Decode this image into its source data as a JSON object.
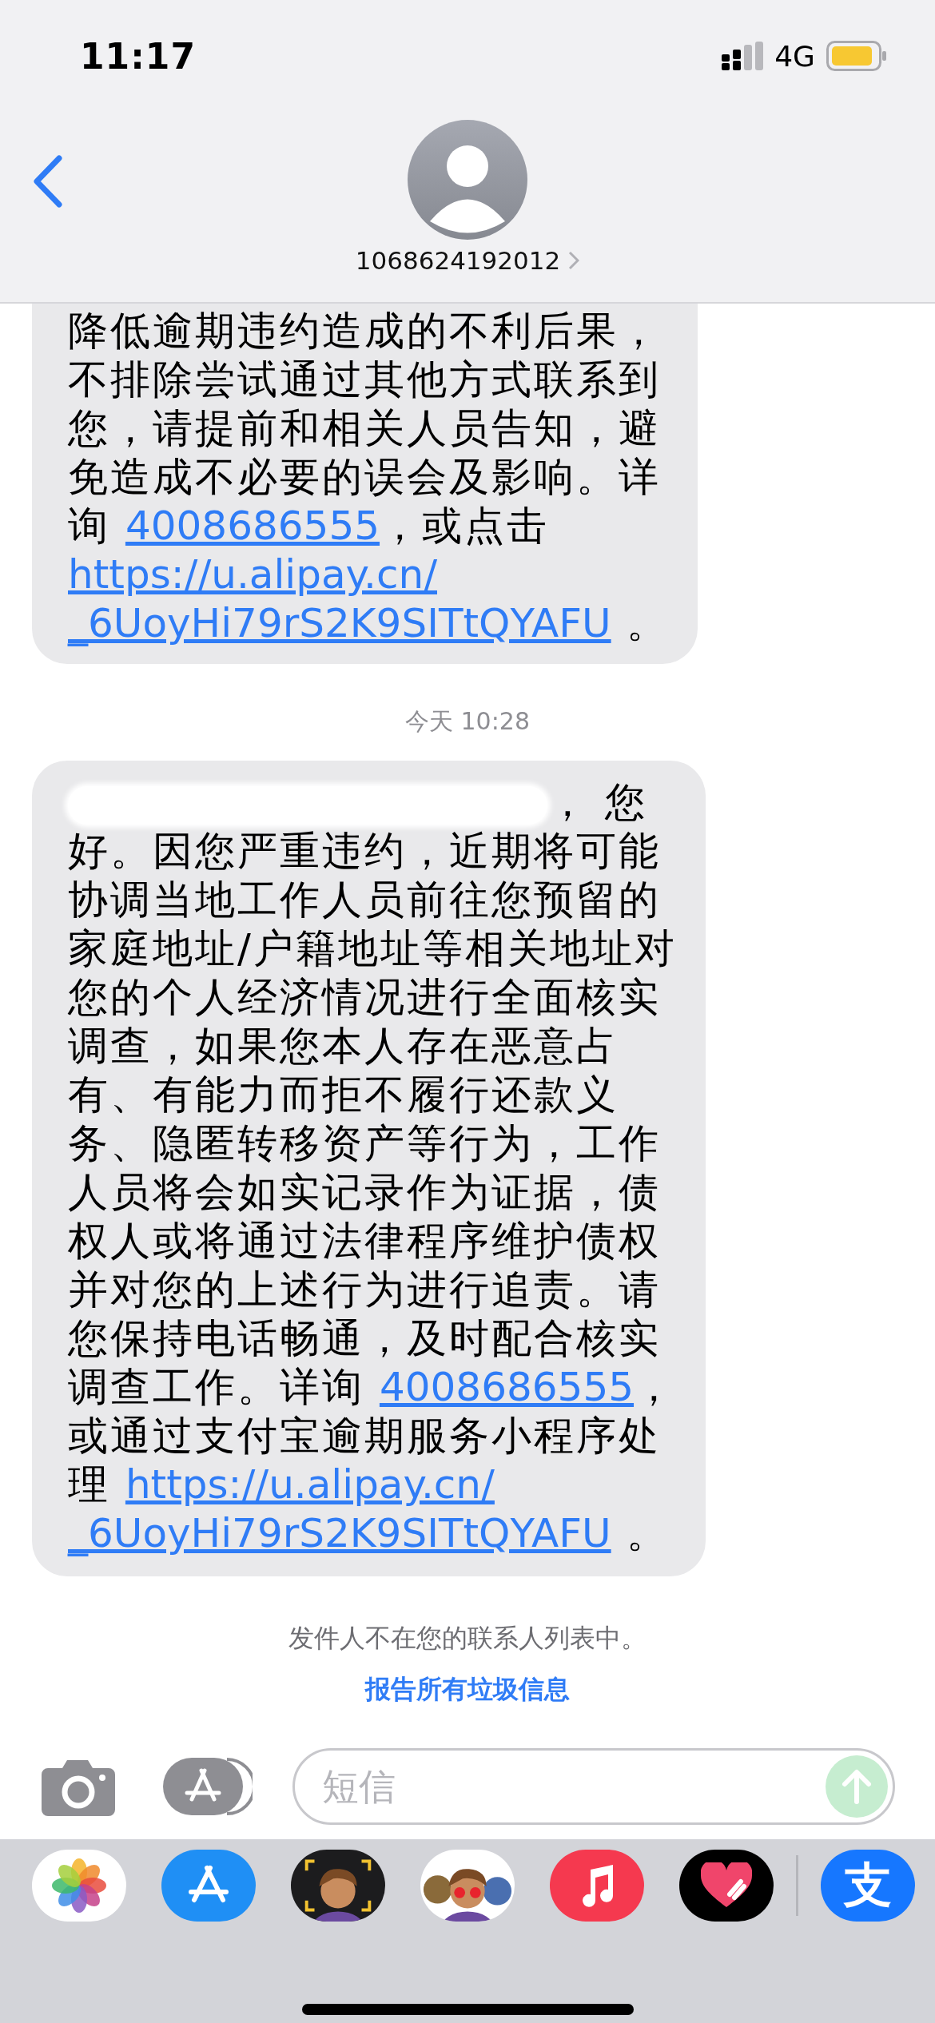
{
  "status_bar": {
    "time": "11:17",
    "network": "4G"
  },
  "header": {
    "contact": "1068624192012"
  },
  "conversation": [
    {
      "kind": "message",
      "cut_top": true,
      "segments": [
        {
          "kind": "text",
          "text": "降低逾期违约造成的不利后果，"
        },
        {
          "kind": "break"
        },
        {
          "kind": "text",
          "text": "不排除尝试通过其他方式联系到"
        },
        {
          "kind": "break"
        },
        {
          "kind": "text",
          "text": "您，请提前和相关人员告知，避"
        },
        {
          "kind": "break"
        },
        {
          "kind": "text",
          "text": "免造成不必要的误会及影响。详"
        },
        {
          "kind": "break"
        },
        {
          "kind": "text",
          "text": "询 "
        },
        {
          "kind": "link",
          "text": "4008686555"
        },
        {
          "kind": "text",
          "text": "，或点击"
        },
        {
          "kind": "break"
        },
        {
          "kind": "link",
          "text": "https://u.alipay.cn/"
        },
        {
          "kind": "break"
        },
        {
          "kind": "link",
          "text": "_6UoyHi79rS2K9SITtQYAFU"
        },
        {
          "kind": "text",
          "text": " 。"
        }
      ]
    },
    {
      "kind": "timestamp",
      "text": "今天 10:28"
    },
    {
      "kind": "message",
      "cut_top": false,
      "segments": [
        {
          "kind": "redacted"
        },
        {
          "kind": "text",
          "text": "， 您"
        },
        {
          "kind": "break"
        },
        {
          "kind": "text",
          "text": "好。因您严重违约，近期将可能"
        },
        {
          "kind": "break"
        },
        {
          "kind": "text",
          "text": "协调当地工作人员前往您预留的"
        },
        {
          "kind": "break"
        },
        {
          "kind": "text",
          "text": "家庭地址/户籍地址等相关地址对"
        },
        {
          "kind": "break"
        },
        {
          "kind": "text",
          "text": "您的个人经济情况进行全面核实"
        },
        {
          "kind": "break"
        },
        {
          "kind": "text",
          "text": "调查，如果您本人存在恶意占"
        },
        {
          "kind": "break"
        },
        {
          "kind": "text",
          "text": "有、有能力而拒不履行还款义"
        },
        {
          "kind": "break"
        },
        {
          "kind": "text",
          "text": "务、隐匿转移资产等行为，工作"
        },
        {
          "kind": "break"
        },
        {
          "kind": "text",
          "text": "人员将会如实记录作为证据，债"
        },
        {
          "kind": "break"
        },
        {
          "kind": "text",
          "text": "权人或将通过法律程序维护债权"
        },
        {
          "kind": "break"
        },
        {
          "kind": "text",
          "text": "并对您的上述行为进行追责。请"
        },
        {
          "kind": "break"
        },
        {
          "kind": "text",
          "text": "您保持电话畅通，及时配合核实"
        },
        {
          "kind": "break"
        },
        {
          "kind": "text",
          "text": "调查工作。详询 "
        },
        {
          "kind": "link",
          "text": "4008686555"
        },
        {
          "kind": "text",
          "text": "，"
        },
        {
          "kind": "break"
        },
        {
          "kind": "text",
          "text": "或通过支付宝逾期服务小程序处"
        },
        {
          "kind": "break"
        },
        {
          "kind": "text",
          "text": "理 "
        },
        {
          "kind": "link",
          "text": "https://u.alipay.cn/"
        },
        {
          "kind": "break"
        },
        {
          "kind": "link",
          "text": "_6UoyHi79rS2K9SITtQYAFU"
        },
        {
          "kind": "text",
          "text": " 。"
        }
      ]
    }
  ],
  "notice": {
    "text": "发件人不在您的联系人列表中。",
    "link": "报告所有垃圾信息"
  },
  "composer": {
    "placeholder": "短信"
  },
  "app_drawer": [
    {
      "kind": "photos"
    },
    {
      "kind": "app-store"
    },
    {
      "kind": "memoji"
    },
    {
      "kind": "stickers"
    },
    {
      "kind": "music"
    },
    {
      "kind": "digital-touch"
    },
    {
      "kind": "alipay",
      "glyph": "支"
    }
  ]
}
